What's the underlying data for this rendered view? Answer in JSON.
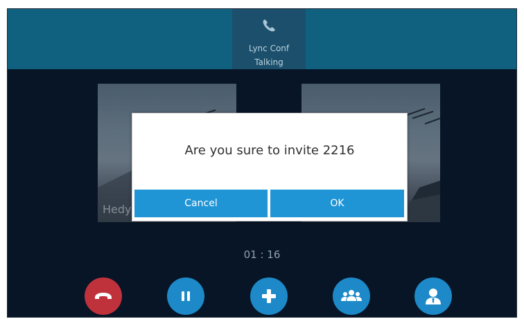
{
  "call": {
    "line_name": "Lync Conf",
    "line_state": "Talking",
    "timer": "01 : 16"
  },
  "participants": [
    {
      "name": "Hedy"
    },
    {
      "name": ""
    }
  ],
  "dialog": {
    "message": "Are you sure to invite 2216",
    "cancel_label": "Cancel",
    "ok_label": "OK"
  },
  "actions": [
    {
      "icon": "end-call-icon",
      "color": "#c0323b"
    },
    {
      "icon": "hold-icon",
      "color": "#1d89c8"
    },
    {
      "icon": "add-icon",
      "color": "#1d89c8"
    },
    {
      "icon": "conference-icon",
      "color": "#1d89c8"
    },
    {
      "icon": "contact-icon",
      "color": "#1d89c8"
    }
  ],
  "colors": {
    "topbar": "#10607f",
    "screen_bg": "#0a1a2c",
    "button_blue": "#1f95d6"
  }
}
